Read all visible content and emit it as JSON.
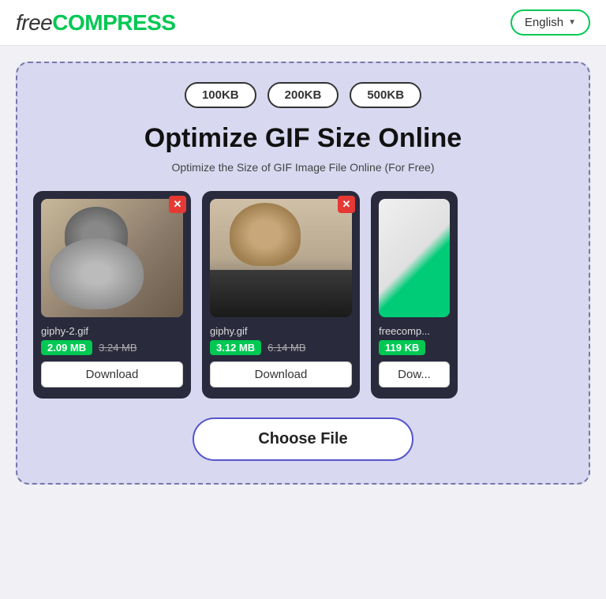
{
  "header": {
    "logo_free": "free",
    "logo_compress": "COMPRESS",
    "lang_label": "English",
    "lang_chevron": "▼"
  },
  "size_options": {
    "btn1": "100KB",
    "btn2": "200KB",
    "btn3": "500KB"
  },
  "hero": {
    "title": "Optimize GIF Size Online",
    "subtitle": "Optimize the Size of GIF Image File Online (For Free)"
  },
  "files": [
    {
      "name": "giphy-2.gif",
      "new_size": "2.09 MB",
      "old_size": "3.24 MB",
      "download": "Download",
      "type": "cat1"
    },
    {
      "name": "giphy.gif",
      "new_size": "3.12 MB",
      "old_size": "6.14 MB",
      "download": "Download",
      "type": "cat2"
    },
    {
      "name": "freecomp...",
      "new_size": "119 KB",
      "old_size": "",
      "download": "Dow...",
      "type": "cat3"
    }
  ],
  "choose_file_btn": "Choose File"
}
